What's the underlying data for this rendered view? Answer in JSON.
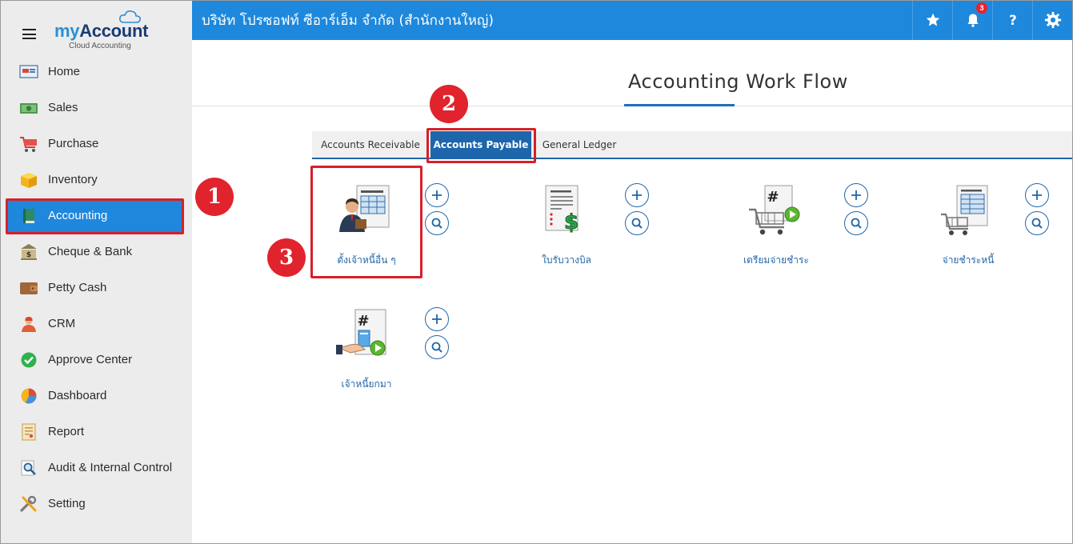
{
  "app": {
    "logo_my": "my",
    "logo_account": "Account",
    "logo_sub": "Cloud Accounting"
  },
  "topbar": {
    "company": "บริษัท โปรซอฟท์ ซีอาร์เอ็ม จำกัด (สำนักงานใหญ่)",
    "notification_count": "3"
  },
  "sidebar": {
    "items": [
      {
        "label": "Home",
        "icon": "home-icon"
      },
      {
        "label": "Sales",
        "icon": "money-icon"
      },
      {
        "label": "Purchase",
        "icon": "cart-icon"
      },
      {
        "label": "Inventory",
        "icon": "box-icon"
      },
      {
        "label": "Accounting",
        "icon": "book-icon",
        "active": true
      },
      {
        "label": "Cheque & Bank",
        "icon": "bank-icon"
      },
      {
        "label": "Petty Cash",
        "icon": "wallet-icon"
      },
      {
        "label": "CRM",
        "icon": "people-icon"
      },
      {
        "label": "Approve Center",
        "icon": "check-icon"
      },
      {
        "label": "Dashboard",
        "icon": "pie-chart-icon"
      },
      {
        "label": "Report",
        "icon": "report-icon"
      },
      {
        "label": "Audit & Internal Control",
        "icon": "magnifier-icon"
      },
      {
        "label": "Setting",
        "icon": "tools-icon"
      }
    ]
  },
  "main": {
    "title": "Accounting Work Flow",
    "tabs": [
      {
        "label": "Accounts Receivable"
      },
      {
        "label": "Accounts Payable",
        "active": true
      },
      {
        "label": "General Ledger"
      }
    ],
    "tiles": [
      {
        "label": "ตั้งเจ้าหนี้อื่น ๆ",
        "icon": "person-document-icon"
      },
      {
        "label": "ใบรับวางบิล",
        "icon": "bill-dollar-icon"
      },
      {
        "label": "เตรียมจ่ายชำระ",
        "icon": "cart-play-icon"
      },
      {
        "label": "จ่ายชำระหนี้",
        "icon": "cart-document-icon"
      },
      {
        "label": "เจ้าหนี้ยกมา",
        "icon": "hand-document-icon"
      }
    ]
  },
  "steps": [
    "1",
    "2",
    "3"
  ],
  "colors": {
    "primary": "#1e88dc",
    "tab_active": "#1d66ab",
    "highlight": "#d71f2a",
    "sidebar_bg": "#ececec"
  }
}
